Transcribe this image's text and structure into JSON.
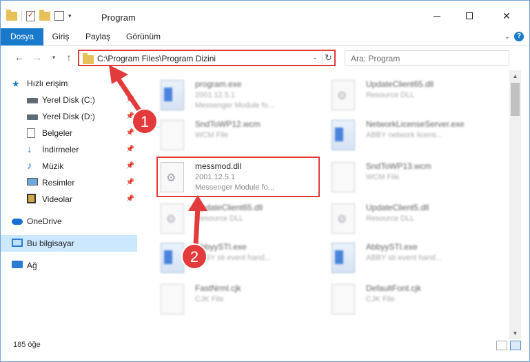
{
  "window": {
    "title": "Program",
    "minimize_label": "–",
    "maximize_label": "□",
    "close_label": "✕"
  },
  "ribbon": {
    "tabs": [
      "Dosya",
      "Giriş",
      "Paylaş",
      "Görünüm"
    ]
  },
  "address_bar": {
    "path": "C:\\Program Files\\Program Dizini",
    "search_placeholder": "Ara: Program"
  },
  "sidebar": {
    "items": [
      {
        "label": "Hızlı erişim",
        "icon": "star-icon"
      },
      {
        "label": "Yerel Disk (C:)",
        "icon": "drive-icon",
        "pinned": true
      },
      {
        "label": "Yerel Disk (D:)",
        "icon": "drive-icon",
        "pinned": true
      },
      {
        "label": "Belgeler",
        "icon": "documents-icon",
        "pinned": true
      },
      {
        "label": "İndirmeler",
        "icon": "downloads-icon",
        "pinned": true
      },
      {
        "label": "Müzik",
        "icon": "music-icon",
        "pinned": true
      },
      {
        "label": "Resimler",
        "icon": "pictures-icon",
        "pinned": true
      },
      {
        "label": "Videolar",
        "icon": "videos-icon",
        "pinned": true
      },
      {
        "label": "OneDrive",
        "icon": "onedrive-icon"
      },
      {
        "label": "Bu bilgisayar",
        "icon": "this-pc-icon",
        "selected": true
      },
      {
        "label": "Ağ",
        "icon": "network-icon"
      }
    ]
  },
  "files": [
    {
      "name": "program.exe",
      "meta1": "2001.12.5.1",
      "meta2": "Messenger Module fo...",
      "type": "exe"
    },
    {
      "name": "UpdateClient65.dll",
      "meta1": "Resource DLL",
      "meta2": "",
      "type": "dll"
    },
    {
      "name": "SndToWP12.wcm",
      "meta1": "WCM File",
      "meta2": "",
      "type": "file"
    },
    {
      "name": "NetworkLicenseServer.exe",
      "meta1": "ABBY network licens...",
      "meta2": "",
      "type": "exe"
    },
    {
      "name": "messmod.dll",
      "meta1": "2001.12.5.1",
      "meta2": "Messenger Module fo...",
      "type": "dll"
    },
    {
      "name": "SndToWP13.wcm",
      "meta1": "WCM File",
      "meta2": "",
      "type": "file"
    },
    {
      "name": "UpdateClient65.dll",
      "meta1": "Resource DLL",
      "meta2": "",
      "type": "dll"
    },
    {
      "name": "UpdateClient5.dll",
      "meta1": "Resource DLL",
      "meta2": "",
      "type": "dll"
    },
    {
      "name": "AbbyySTI.exe",
      "meta1": "ABBY sti event hand...",
      "meta2": "",
      "type": "exe"
    },
    {
      "name": "AbbyySTI.exe",
      "meta1": "ABBY sti event hand...",
      "meta2": "",
      "type": "exe"
    },
    {
      "name": "FastNrml.cjk",
      "meta1": "CJK File",
      "meta2": "",
      "type": "file"
    },
    {
      "name": "DefaultFont.cjk",
      "meta1": "CJK File",
      "meta2": "",
      "type": "file"
    }
  ],
  "status": {
    "item_count": "185 öğe"
  },
  "annotations": {
    "step1": "1",
    "step2": "2",
    "accent_color": "#e33b3b"
  }
}
